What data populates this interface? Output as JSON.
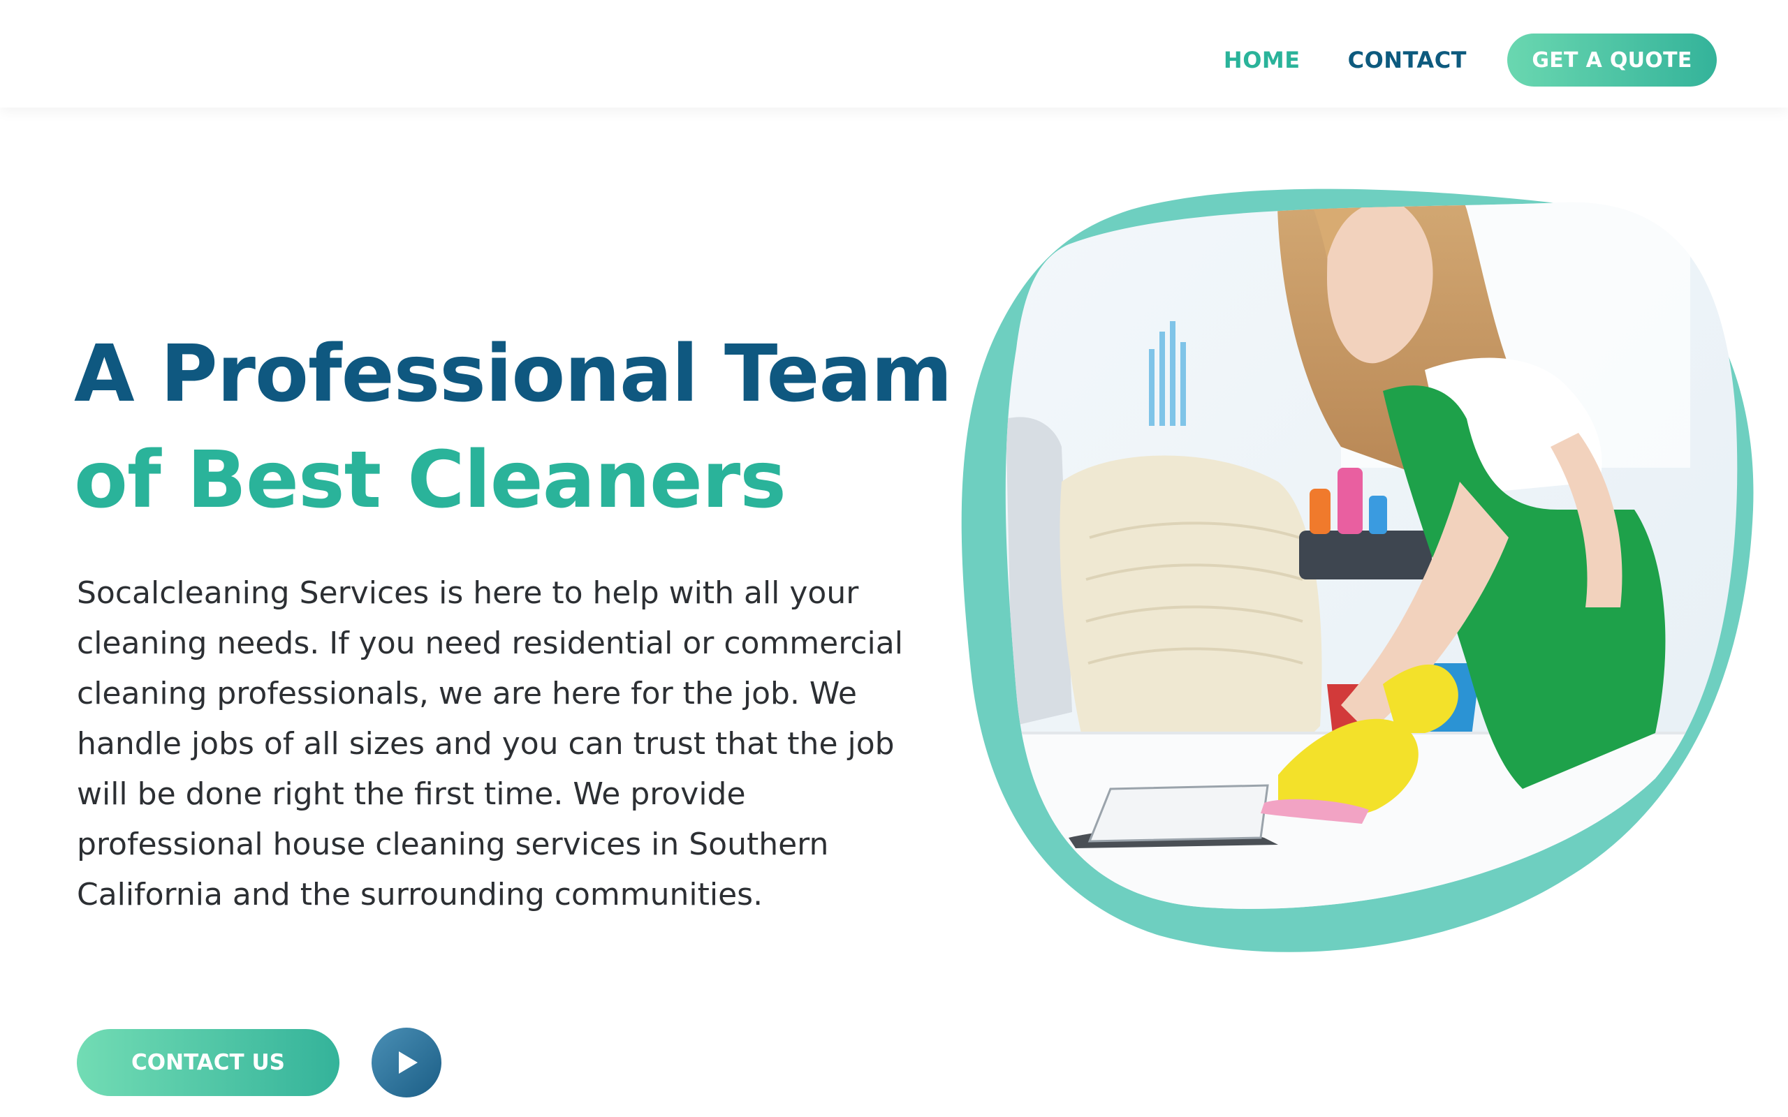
{
  "nav": {
    "items": [
      {
        "label": "HOME",
        "active": true
      },
      {
        "label": "CONTACT",
        "active": false
      }
    ],
    "cta_label": "GET A QUOTE"
  },
  "hero": {
    "title_line1": "A Professional Team",
    "title_line2": "of Best Cleaners",
    "description": "Socalcleaning Services is here to help with all your cleaning needs. If you need residential or commercial cleaning professionals, we are here for the job. We handle jobs of all sizes and you can trust that the job will be done right the first time. We provide professional house cleaning services in Southern California and the surrounding communities.",
    "primary_button": "CONTACT US",
    "play_icon": "play-icon"
  },
  "colors": {
    "brand_dark": "#0f5880",
    "brand_teal": "#2ab39a",
    "blob_teal": "#6ecfc0",
    "apron_green": "#1ea14a",
    "glove_yellow": "#f3e12a"
  }
}
